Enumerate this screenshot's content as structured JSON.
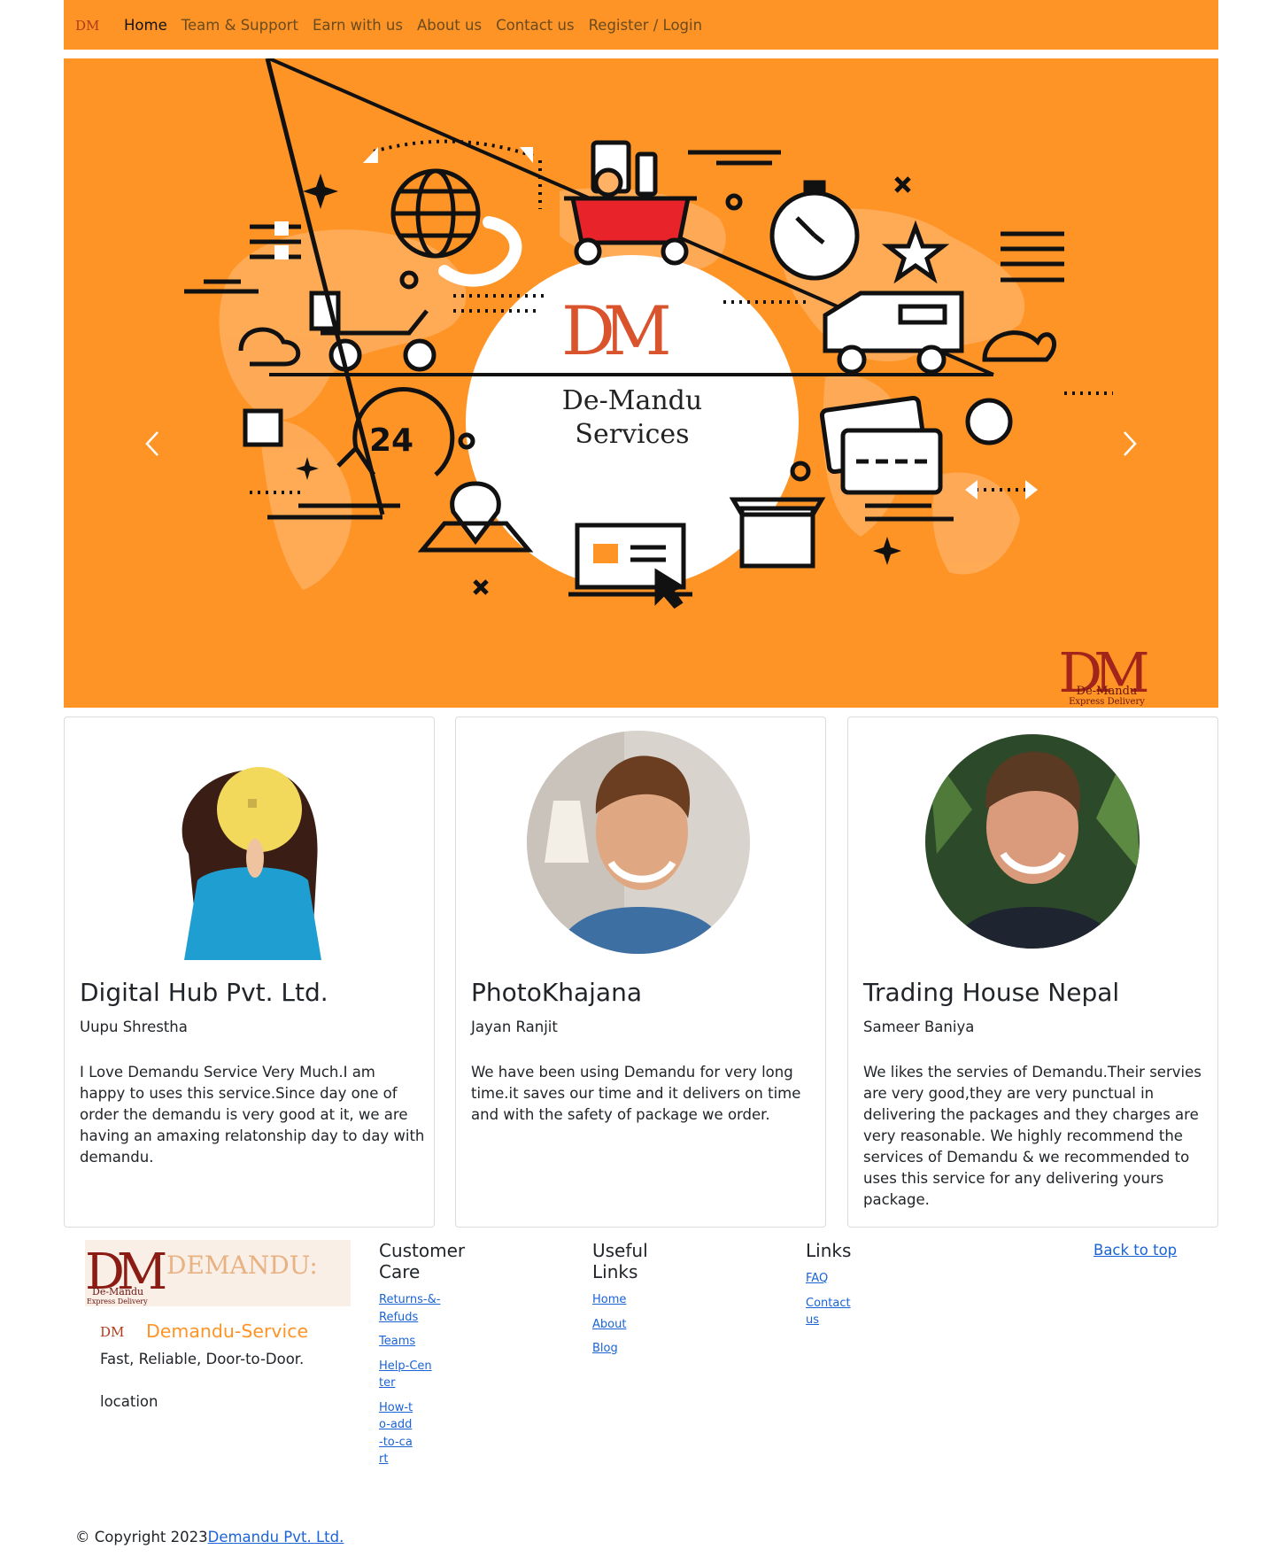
{
  "nav": {
    "logo_text": "DM",
    "items": [
      {
        "label": "Home",
        "active": true
      },
      {
        "label": "Team & Support"
      },
      {
        "label": "Earn with us"
      },
      {
        "label": "About us"
      },
      {
        "label": "Contact us"
      },
      {
        "label": "Register / Login"
      }
    ]
  },
  "hero": {
    "logo_text": "DM",
    "title_line1": "De-Mandu",
    "title_line2": "Services",
    "clock_number": "24",
    "corner_logo": "DM",
    "corner_logo_sub1": "De-Mandu",
    "corner_logo_sub2": "Express Delivery",
    "colors": {
      "background": "#fe9426",
      "accent": "#e8232a"
    }
  },
  "testimonials": [
    {
      "company": "Digital Hub Pvt. Ltd.",
      "person": "Uupu Shrestha",
      "quote": "I Love Demandu Service Very Much.I am happy to uses this service.Since day one of order the demandu is very good at it, we are having an amaxing relatonship day to day with demandu."
    },
    {
      "company": "PhotoKhajana",
      "person": "Jayan Ranjit",
      "quote": "We have been using Demandu for very long time.it saves our time and it delivers on time and with the safety of package we order."
    },
    {
      "company": "Trading House Nepal",
      "person": "Sameer Baniya",
      "quote": "We likes the servies of Demandu.Their servies are very good,they are very punctual in delivering the packages and they charges are very reasonable. We highly recommend the services of Demandu & we recommended to uses this service for any delivering yours package."
    }
  ],
  "footer": {
    "logo_text": "DM",
    "logo_word": "DEMANDU:",
    "logo_sub1": "De-Mandu",
    "logo_sub2": "Express Delivery",
    "brand_name": "Demandu-Service",
    "tagline": "Fast, Reliable, Door-to-Door.",
    "location": "location",
    "customer_care": {
      "title_line1": "Customer",
      "title_line2": "Care",
      "links": [
        "Returns-&-Refuds",
        "Teams",
        "Help-Center",
        "How-to-add-to-cart"
      ]
    },
    "useful_links": {
      "title_line1": "Useful",
      "title_line2": "Links",
      "links": [
        "Home",
        "About",
        "Blog"
      ]
    },
    "links": {
      "title": "Links",
      "links": [
        "FAQ",
        "Contact us"
      ]
    },
    "back_to_top": "Back to top",
    "copyright": "© Copyright 2023",
    "company_link": "Demandu Pvt. Ltd."
  }
}
